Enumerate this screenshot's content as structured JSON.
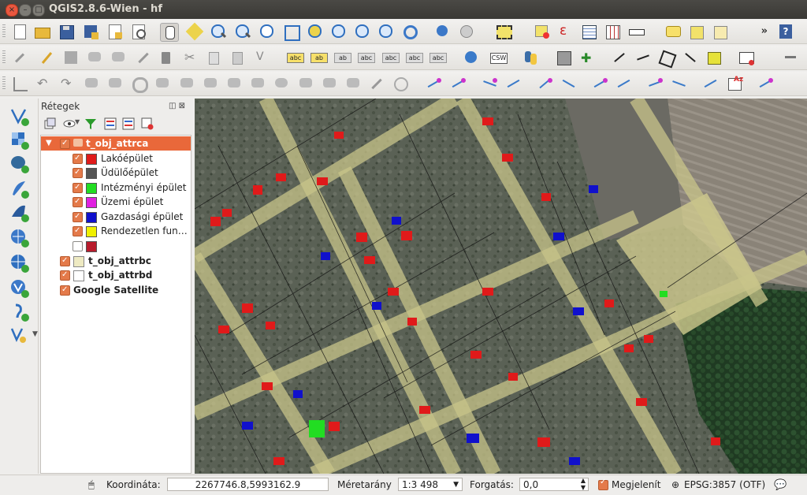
{
  "window": {
    "title": "QGIS2.8.6-Wien - hf"
  },
  "panel": {
    "title": "Rétegek",
    "layers": [
      {
        "label": "t_obj_attrca",
        "checked": true,
        "selected": true,
        "bold": true
      },
      {
        "label": "Lakóépület",
        "checked": true,
        "color": "#e01a1a"
      },
      {
        "label": "Üdülőépület",
        "checked": true,
        "color": "#555555"
      },
      {
        "label": "Intézményi épület",
        "checked": true,
        "color": "#22dd22"
      },
      {
        "label": "Üzemi épület",
        "checked": true,
        "color": "#e020e0"
      },
      {
        "label": "Gazdasági épület",
        "checked": true,
        "color": "#1010cc"
      },
      {
        "label": "Rendezetlen fun…",
        "checked": true,
        "color": "#f0f000"
      },
      {
        "label": "",
        "checked": false,
        "color": "#b81c2c"
      },
      {
        "label": "t_obj_attrbc",
        "checked": true,
        "color": "#eeeac2",
        "bold": true
      },
      {
        "label": "t_obj_attrbd",
        "checked": true,
        "color": "#ffffff",
        "bold": true
      },
      {
        "label": "Google Satellite",
        "checked": true,
        "bold": true
      }
    ]
  },
  "statusbar": {
    "coord_label": "Koordináta:",
    "coord_value": "2267746.8,5993162.9",
    "scale_label": "Méretarány",
    "scale_value": "1:3 498",
    "rotation_label": "Forgatás:",
    "rotation_value": "0,0",
    "render_label": "Megjelenít",
    "crs_label": "EPSG:3857 (OTF)"
  },
  "toolbar": {
    "overflow": "»"
  },
  "colors": {
    "accent": "#e9683a",
    "road": "#c8c48a"
  }
}
